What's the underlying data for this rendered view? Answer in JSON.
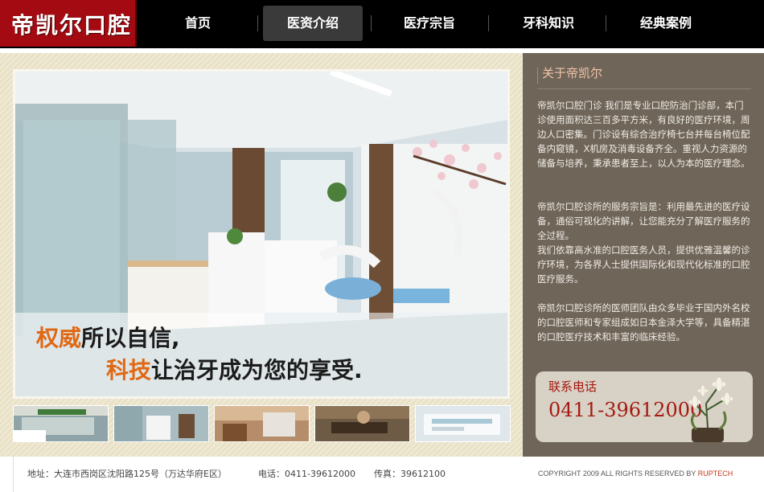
{
  "logo": {
    "text": "帝凯尔口腔"
  },
  "nav": {
    "items": [
      {
        "label": "首页"
      },
      {
        "label": "医资介绍",
        "active": true
      },
      {
        "label": "医疗宗旨"
      },
      {
        "label": "牙科知识"
      },
      {
        "label": "经典案例"
      }
    ]
  },
  "banner": {
    "slogan_line1_highlight": "权威",
    "slogan_line1_rest": "所以自信,",
    "slogan_line2_highlight": "科技",
    "slogan_line2_rest": "让治牙成为您的享受.",
    "highlight_color": "#e06814"
  },
  "thumbnails": {
    "count": 5
  },
  "sidebar": {
    "title": "关于帝凯尔",
    "paragraphs": [
      "帝凯尔口腔门诊 我们是专业口腔防治门诊部，本门诊使用面积达三百多平方米，有良好的医疗环境，周边人口密集。门诊设有综合治疗椅七台并每台椅位配备内窥镜，X机房及消毒设备齐全。重视人力资源的储备与培养，秉承患者至上，以人为本的医疗理念。",
      "帝凯尔口腔诊所的服务宗旨是：利用最先进的医疗设备，通俗可视化的讲解，让您能充分了解医疗服务的全过程。",
      "我们依靠高水准的口腔医务人员，提供优雅温馨的诊疗环境，为各界人士提供国际化和现代化标准的口腔医疗服务。",
      "帝凯尔口腔诊所的医师团队由众多毕业于国内外名校的口腔医师和专家组成如日本金泽大学等，具备精湛的口腔医疗技术和丰富的临床经验。"
    ],
    "contact_label": "联系电话",
    "contact_phone": "0411-39612000"
  },
  "footer": {
    "address": "地址：大连市西岗区沈阳路125号（万达华府E区）",
    "phone": "电话：0411-39612000",
    "fax": "传真：39612100",
    "copyright_prefix": "COPYRIGHT 2009 ALL RIGHTS RESERVED BY ",
    "copyright_brand": "RUPTECH"
  },
  "colors": {
    "logo_bg": "#a30a12",
    "nav_bg": "#000000",
    "sidebar_bg": "#6f6559",
    "accent_red": "#a51a12"
  }
}
